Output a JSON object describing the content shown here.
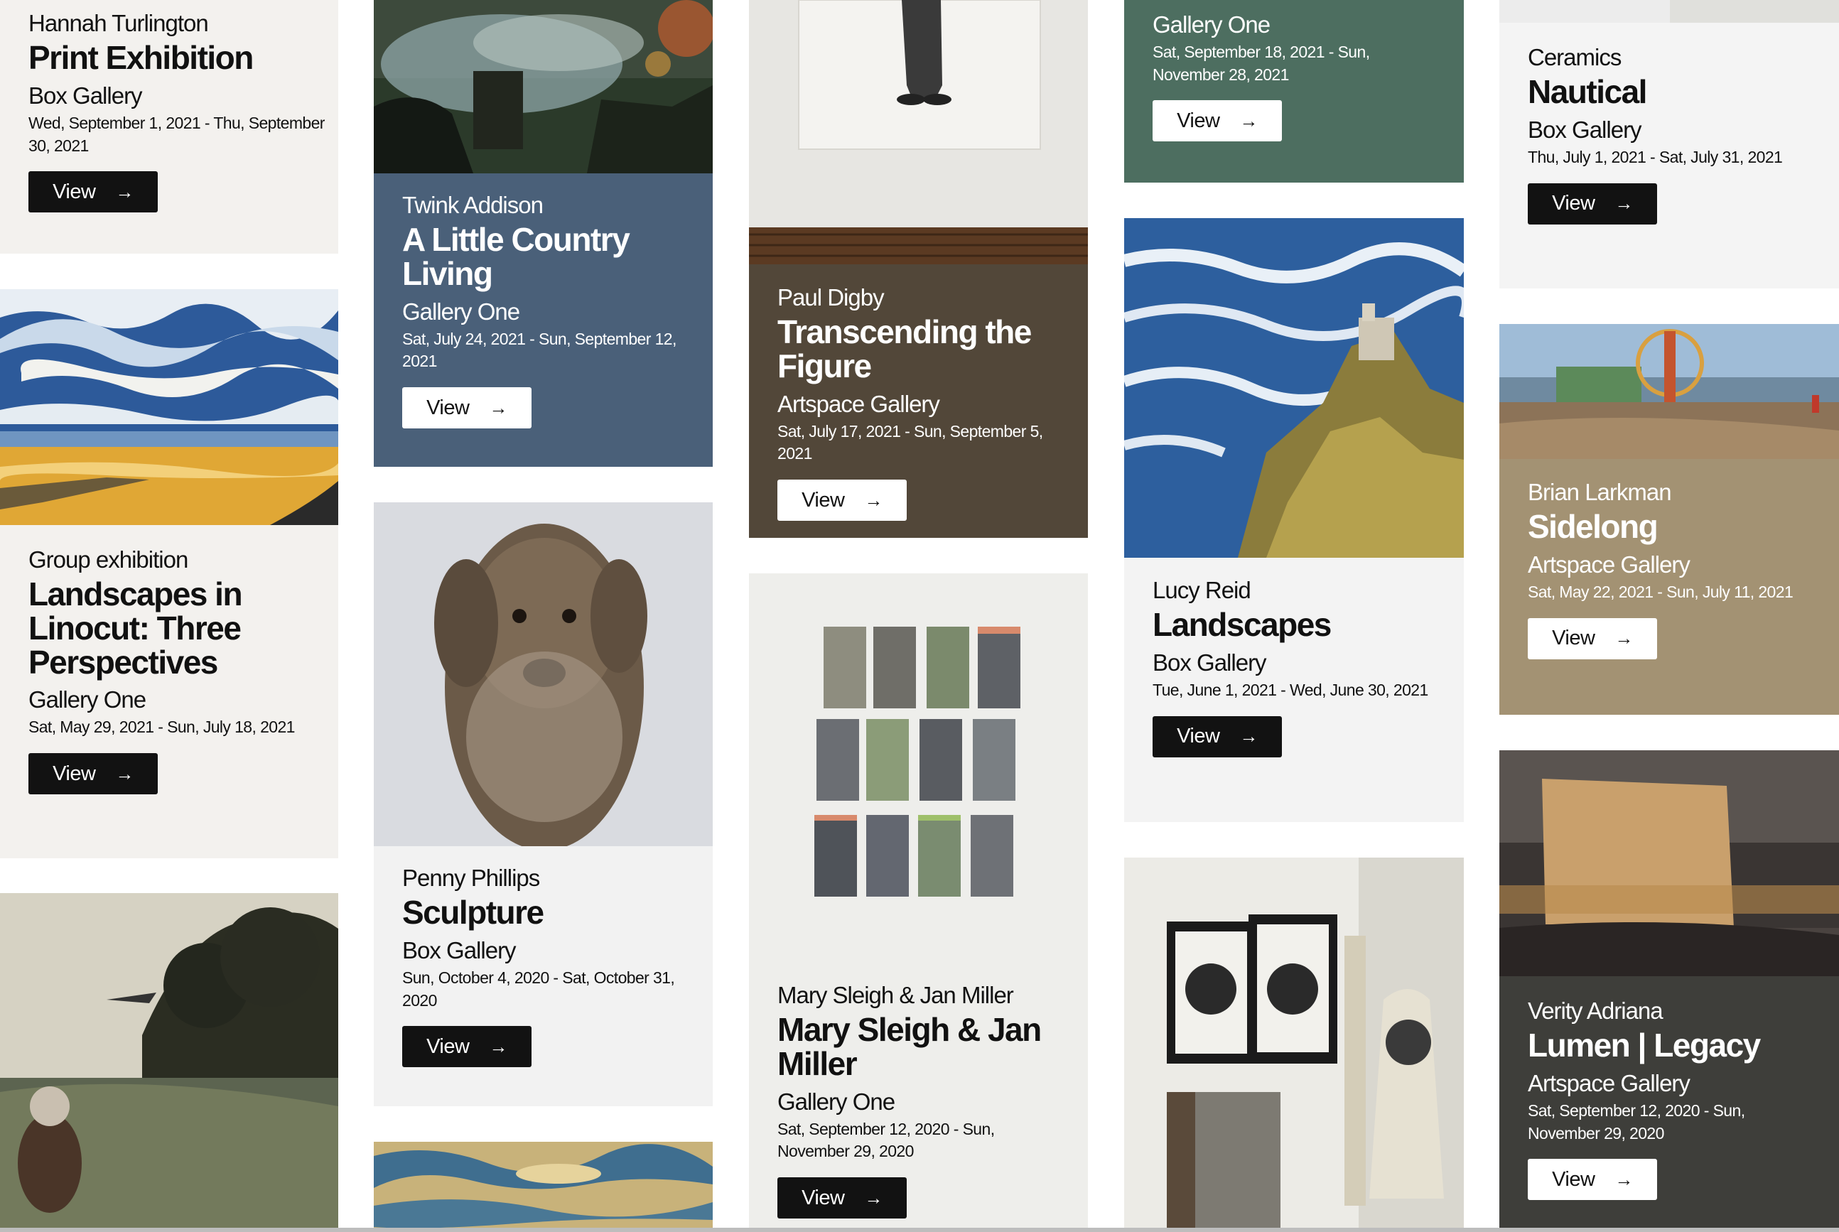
{
  "cards": [
    {
      "artist": "Hannah Turlington",
      "title": "Print Exhibition",
      "venue": "Box Gallery",
      "dates": "Wed, September 1, 2021 - Thu, September 30, 2021",
      "button": "View",
      "bg": "#f3f1ee"
    },
    {
      "artist": "Group exhibition",
      "title": "Landscapes in Linocut: Three Perspectives",
      "venue": "Gallery One",
      "dates": "Sat, May 29, 2021 - Sun, July 18, 2021",
      "button": "View",
      "bg": "#f3f1ee"
    },
    {
      "artist": "Twink Addison",
      "title": "A Little Country Living",
      "venue": "Gallery One",
      "dates": "Sat, July 24, 2021 - Sun, September 12, 2021",
      "button": "View",
      "bg": "#4a6079"
    },
    {
      "artist": "Penny Phillips",
      "title": "Sculpture",
      "venue": "Box Gallery",
      "dates": "Sun, October 4, 2020 - Sat, October 31, 2020",
      "button": "View",
      "bg": "#f2f2f2"
    },
    {
      "artist": "Paul Digby",
      "title": "Transcending the Figure",
      "venue": "Artspace Gallery",
      "dates": "Sat, July 17, 2021 - Sun, September 5, 2021",
      "button": "View",
      "bg": "#524739"
    },
    {
      "artist": "Mary Sleigh & Jan Miller",
      "title": "Mary Sleigh & Jan Miller",
      "venue": "Gallery One",
      "dates": "Sat, September 12, 2020 - Sun, November 29, 2020",
      "button": "View",
      "bg": "#eeeeeb"
    },
    {
      "venue": "Gallery One",
      "dates": "Sat, September 18, 2021 - Sun, November 28, 2021",
      "button": "View",
      "bg": "#4d6e60"
    },
    {
      "artist": "Lucy Reid",
      "title": "Landscapes",
      "venue": "Box Gallery",
      "dates": "Tue, June 1, 2021 - Wed, June 30, 2021",
      "button": "View",
      "bg": "#f3f3f3"
    },
    {
      "artist": "Ceramics",
      "title": "Nautical",
      "venue": "Box Gallery",
      "dates": "Thu, July 1, 2021 - Sat, July 31, 2021",
      "button": "View",
      "bg": "#f4f4f4"
    },
    {
      "artist": "Brian Larkman",
      "title": "Sidelong",
      "venue": "Artspace Gallery",
      "dates": "Sat, May 22, 2021 - Sun, July 11, 2021",
      "button": "View",
      "bg": "#a39273"
    },
    {
      "artist": "Verity Adriana",
      "title": "Lumen | Legacy",
      "venue": "Artspace Gallery",
      "dates": "Sat, September 12, 2020 - Sun, November 29, 2020",
      "button": "View",
      "bg": "#3e3e3a"
    }
  ],
  "arrow_icon": "arrow-right-icon"
}
